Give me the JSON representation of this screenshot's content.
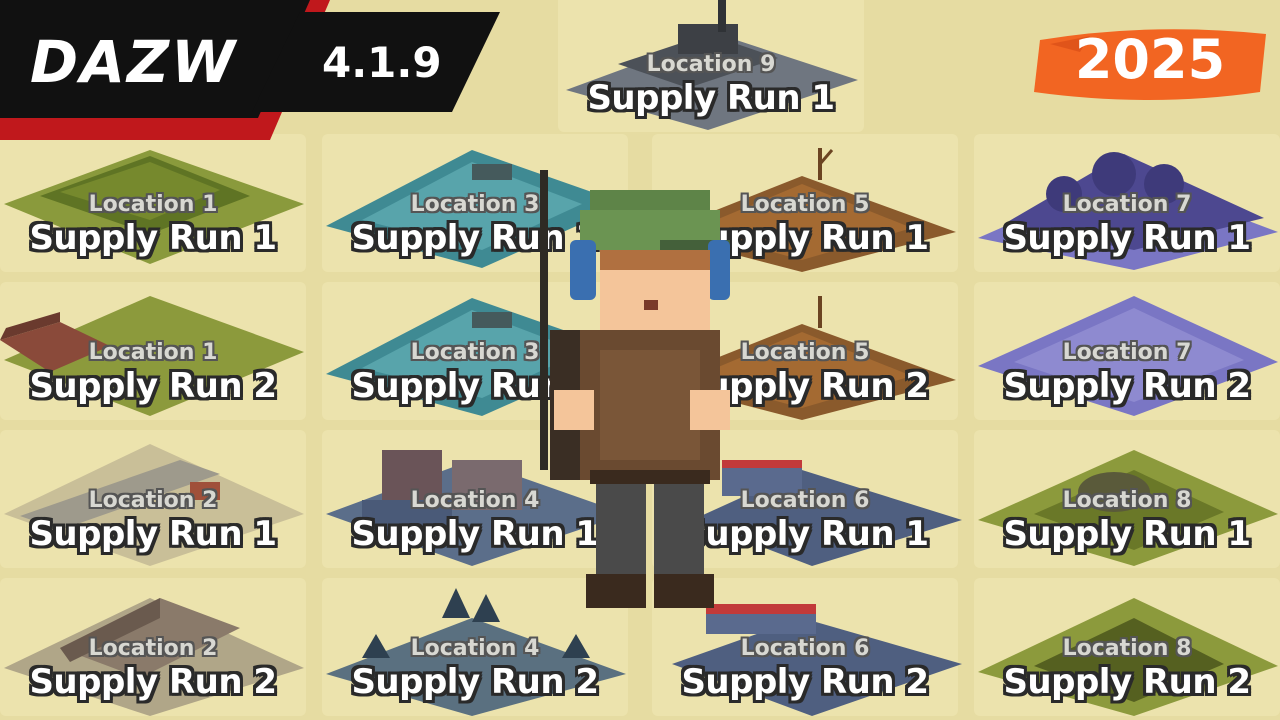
{
  "brand": {
    "name": "DAZW",
    "version": "4.1.9"
  },
  "badge": {
    "year": "2025"
  },
  "colors": {
    "banner_black": "#111111",
    "banner_red": "#c0181c",
    "year_orange": "#f26522",
    "background": "#e6dca2"
  },
  "locations": [
    {
      "location": "Location 9",
      "run": "Supply Run 1",
      "theme": "industrial-grey"
    },
    {
      "location": "Location 1",
      "run": "Supply Run 1",
      "theme": "cornfield"
    },
    {
      "location": "Location 3",
      "run": "Supply Run 1",
      "theme": "teal-water"
    },
    {
      "location": "Location 5",
      "run": "Supply Run 1",
      "theme": "brown-dirt"
    },
    {
      "location": "Location 7",
      "run": "Supply Run 1",
      "theme": "purple-forest"
    },
    {
      "location": "Location 1",
      "run": "Supply Run 2",
      "theme": "farm-barn"
    },
    {
      "location": "Location 3",
      "run": "Supply Run 2",
      "theme": "teal-water"
    },
    {
      "location": "Location 5",
      "run": "Supply Run 2",
      "theme": "brown-dirt"
    },
    {
      "location": "Location 7",
      "run": "Supply Run 2",
      "theme": "purple-flat"
    },
    {
      "location": "Location 2",
      "run": "Supply Run 1",
      "theme": "road-beige"
    },
    {
      "location": "Location 4",
      "run": "Supply Run 1",
      "theme": "town-blue"
    },
    {
      "location": "Location 6",
      "run": "Supply Run 1",
      "theme": "city-blue"
    },
    {
      "location": "Location 8",
      "run": "Supply Run 1",
      "theme": "military-green"
    },
    {
      "location": "Location 2",
      "run": "Supply Run 2",
      "theme": "warehouse"
    },
    {
      "location": "Location 4",
      "run": "Supply Run 2",
      "theme": "forest-blue"
    },
    {
      "location": "Location 6",
      "run": "Supply Run 2",
      "theme": "city-blue"
    },
    {
      "location": "Location 8",
      "run": "Supply Run 2",
      "theme": "military-green"
    }
  ]
}
